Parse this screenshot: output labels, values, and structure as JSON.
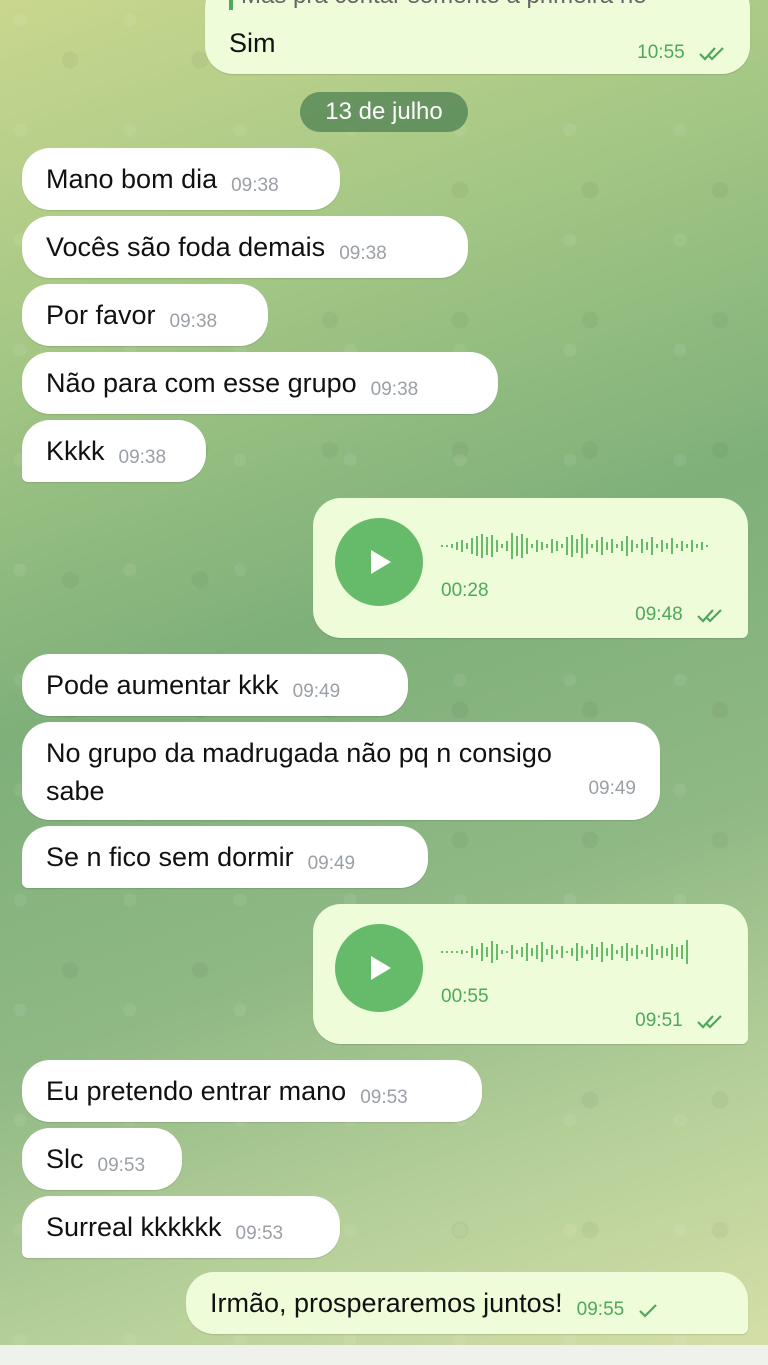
{
  "top_message": {
    "cut_text": "Mas pra contar somente a primeira né",
    "text": "Sim",
    "time": "10:55"
  },
  "date_chip": "13 de julho",
  "messages": [
    {
      "text": "Mano bom dia",
      "time": "09:38"
    },
    {
      "text": "Vocês são foda demais",
      "time": "09:38"
    },
    {
      "text": "Por favor",
      "time": "09:38"
    },
    {
      "text": "Não para com esse grupo",
      "time": "09:38"
    },
    {
      "text": "Kkkk",
      "time": "09:38"
    },
    {
      "text": "Pode aumentar kkk",
      "time": "09:49"
    },
    {
      "text_line1": "No grupo da madrugada não pq n consigo",
      "text_line2": "sabe",
      "time": "09:49"
    },
    {
      "text": "Se n fico sem dormir",
      "time": "09:49"
    },
    {
      "text": "Eu pretendo entrar mano",
      "time": "09:53"
    },
    {
      "text": "Slc",
      "time": "09:53"
    },
    {
      "text": "Surreal kkkkkk",
      "time": "09:53"
    }
  ],
  "voice_messages": [
    {
      "duration": "00:28",
      "time": "09:48",
      "status": "read"
    },
    {
      "duration": "00:55",
      "time": "09:51",
      "status": "read"
    }
  ],
  "last_out": {
    "text": "Irmão, prosperaremos juntos!",
    "time": "09:55",
    "status": "sent"
  },
  "colors": {
    "incoming": "#ffffff",
    "outgoing": "#eefcd9",
    "accent": "#66bb6a",
    "date_chip": "#4d8052"
  },
  "icons": {
    "play": "play-icon",
    "read": "double-check-icon",
    "sent": "check-icon"
  }
}
